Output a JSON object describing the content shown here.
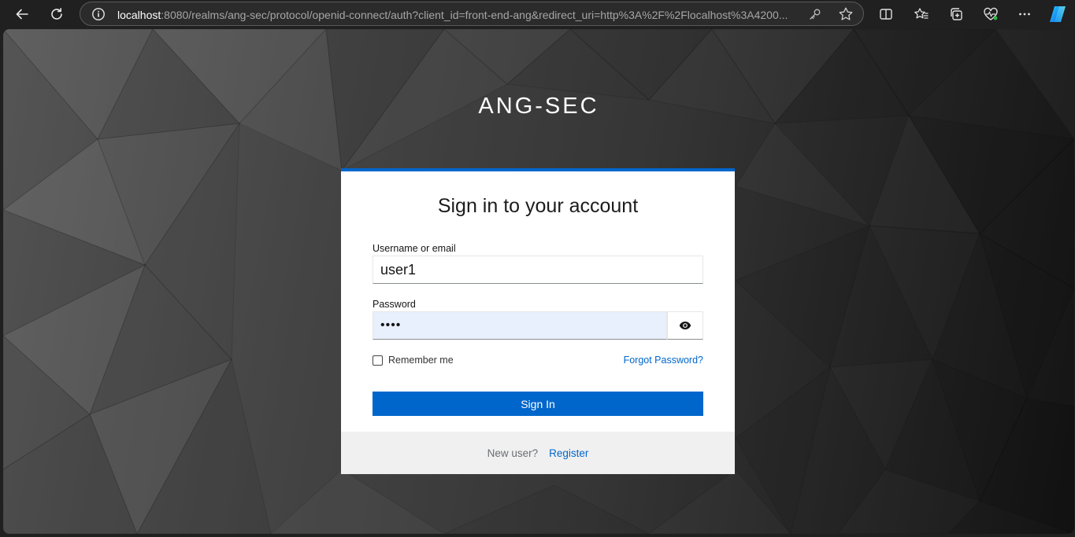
{
  "browser": {
    "url_host": "localhost",
    "url_rest": ":8080/realms/ang-sec/protocol/openid-connect/auth?client_id=front-end-ang&redirect_uri=http%3A%2F%2Flocalhost%3A4200..."
  },
  "page": {
    "realm_title": "ANG-SEC"
  },
  "login": {
    "title": "Sign in to your account",
    "username_label": "Username or email",
    "username_value": "user1",
    "password_label": "Password",
    "password_value": "••••",
    "remember_label": "Remember me",
    "remember_checked": false,
    "forgot_link": "Forgot Password?",
    "signin_button": "Sign In",
    "new_user_text": "New user?",
    "register_link": "Register"
  },
  "colors": {
    "accent": "#0066cc",
    "footer_bg": "#f0f0f0",
    "autofill_bg": "#e8f0fe"
  }
}
